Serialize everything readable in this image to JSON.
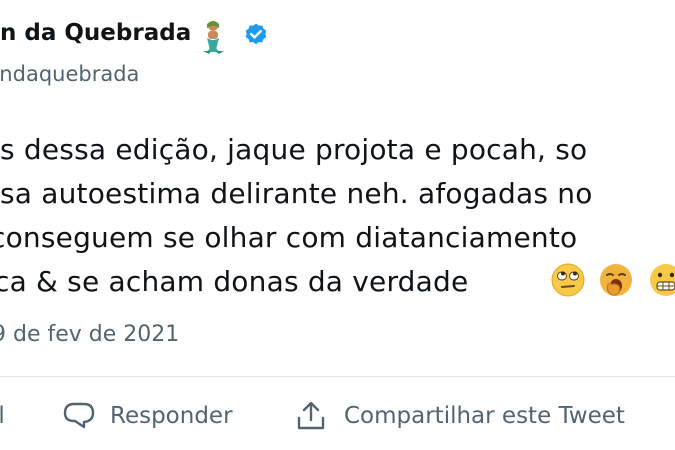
{
  "author": {
    "display_name_visible": "n da Quebrada",
    "handle_visible": "nndaquebrada",
    "emoji_icon": "mermaid-emoji-icon",
    "verified_icon": "verified-badge-icon",
    "verified_color": "#1d9bf0"
  },
  "tweet": {
    "lines": [
      "s dessa edição, jaque projota e pocah, so",
      "sa autoestima delirante neh. afogadas no",
      " conseguem se olhar com diatanciamento",
      "ca & se acham donas da verdade"
    ],
    "trailing_emojis": [
      "eye-roll-emoji-icon",
      "yawning-emoji-icon",
      "grimace-emoji-icon"
    ]
  },
  "timestamp": "9 de fev de 2021",
  "actions": {
    "like_partial_label": "il",
    "reply_label": "Responder",
    "share_label": "Compartilhar este Tweet",
    "icon_color": "#536471"
  }
}
